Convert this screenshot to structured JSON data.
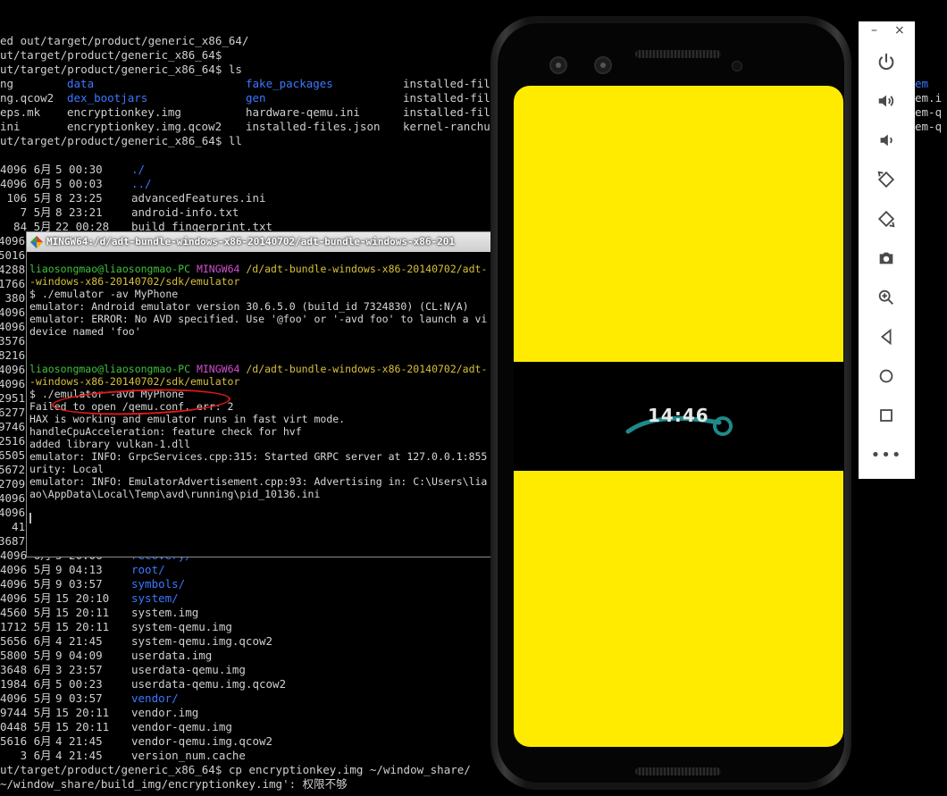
{
  "terminal": {
    "top_lines": [
      "ed out/target/product/generic_x86_64/",
      "ut/target/product/generic_x86_64$",
      "ut/target/product/generic_x86_64$ ls"
    ],
    "ls_rows": [
      [
        "ng",
        "data",
        "fake_packages",
        "installed-fil"
      ],
      [
        "ng.qcow2",
        "dex_bootjars",
        "gen",
        "installed-fil"
      ],
      [
        "eps.mk",
        "encryptionkey.img",
        "hardware-qemu.ini",
        "installed-fil"
      ],
      [
        "ini",
        "encryptionkey.img.qcow2",
        "installed-files.json",
        "kernel-ranchu"
      ]
    ],
    "ls_blue": [
      [
        false,
        true,
        true,
        false
      ],
      [
        false,
        true,
        true,
        false
      ],
      [
        false,
        false,
        false,
        false
      ],
      [
        false,
        false,
        false,
        false
      ]
    ],
    "right_col": [
      "em",
      "em.i",
      "em-q",
      "em-q"
    ],
    "ll_cmd": "ut/target/product/generic_x86_64$ ll",
    "ll_top": [
      [
        "4096 6月",
        "5 00:30",
        "./",
        true
      ],
      [
        "4096 6月",
        "5 00:03",
        "../",
        true
      ],
      [
        " 106 5月",
        "8 23:25",
        "advancedFeatures.ini",
        false
      ],
      [
        "   7 5月",
        "8 23:21",
        "android-info.txt",
        false
      ],
      [
        "  84 5月",
        "22 00:28",
        "build_fingerprint.txt",
        false
      ]
    ],
    "left_sizes": [
      "4096",
      "5016",
      "4288",
      "1766",
      " 380",
      "4096",
      "4096",
      "3576",
      "8216",
      "4096",
      "4096",
      "2951",
      "6277",
      "9746",
      "2516",
      "6505",
      "5672",
      "2709",
      "4096",
      "4096",
      "  41",
      "3687"
    ],
    "ll_bottom": [
      [
        "4096 6月",
        "5 20:06",
        "recovery/",
        true
      ],
      [
        "4096 5月",
        "9 04:13",
        "root/",
        true
      ],
      [
        "4096 5月",
        "9 03:57",
        "symbols/",
        true
      ],
      [
        "4096 5月",
        "15 20:10",
        "system/",
        true
      ],
      [
        "4560 5月",
        "15 20:11",
        "system.img",
        false
      ],
      [
        "1712 5月",
        "15 20:11",
        "system-qemu.img",
        false
      ],
      [
        "5656 6月",
        "4 21:45",
        "system-qemu.img.qcow2",
        false
      ],
      [
        "5800 5月",
        "9 04:09",
        "userdata.img",
        false
      ],
      [
        "3648 6月",
        "3 23:57",
        "userdata-qemu.img",
        false
      ],
      [
        "1984 6月",
        "5 00:23",
        "userdata-qemu.img.qcow2",
        false
      ],
      [
        "4096 5月",
        "9 03:57",
        "vendor/",
        true
      ],
      [
        "9744 5月",
        "15 20:11",
        "vendor.img",
        false
      ],
      [
        "0448 5月",
        "15 20:11",
        "vendor-qemu.img",
        false
      ],
      [
        "5616 6月",
        "4 21:45",
        "vendor-qemu.img.qcow2",
        false
      ],
      [
        "   3 6月",
        "4 21:45",
        "version_num.cache",
        false
      ]
    ],
    "bottom_lines": [
      "ut/target/product/generic_x86_64$ cp encryptionkey.img ~/window_share/",
      "~/window_share/build_img/encryptionkey.img': 权限不够"
    ]
  },
  "mingw": {
    "title": "MINGW64:/d/adt-bundle-windows-x86-20140702/adt-bundle-windows-x86-201",
    "prompt1_user": "liaosongmao@liaosongmao-PC",
    "prompt1_env": "MINGW64",
    "prompt1_path": "/d/adt-bundle-windows-x86-20140702/adt-",
    "prompt1_path2": "-windows-x86-20140702/sdk/emulator",
    "cmd1": "$ ./emulator -av MyPhone",
    "out1": [
      "emulator: Android emulator version 30.6.5.0 (build_id 7324830) (CL:N/A)",
      "emulator: ERROR: No AVD specified. Use '@foo' or '-avd foo' to launch a vi",
      "device named 'foo'"
    ],
    "prompt2_user": "liaosongmao@liaosongmao-PC",
    "prompt2_env": "MINGW64",
    "prompt2_path": "/d/adt-bundle-windows-x86-20140702/adt-",
    "prompt2_path2": "-windows-x86-20140702/sdk/emulator",
    "cmd2": "$ ./emulator -avd MyPhone",
    "out2": [
      "Failed to open /qemu.conf, err: 2",
      "HAX is working and emulator runs in fast virt mode.",
      "handleCpuAcceleration: feature check for hvf",
      "added library vulkan-1.dll",
      "emulator: INFO: GrpcServices.cpp:315: Started GRPC server at 127.0.0.1:855",
      "urity: Local",
      "emulator: INFO: EmulatorAdvertisement.cpp:93: Advertising in: C:\\Users\\lia",
      "ao\\AppData\\Local\\Temp\\avd\\running\\pid_10136.ini"
    ]
  },
  "phone": {
    "clock": "14:46",
    "screen_color": "#ffeb00",
    "arc_color": "#1f8a8a"
  },
  "toolbar": {
    "minimize": "–",
    "close": "×",
    "buttons": [
      "power-icon",
      "volume-up-icon",
      "volume-down-icon",
      "rotate-left-icon",
      "rotate-right-icon",
      "camera-icon",
      "zoom-icon",
      "back-icon",
      "home-icon",
      "overview-icon",
      "more-icon"
    ],
    "more": "•••"
  }
}
